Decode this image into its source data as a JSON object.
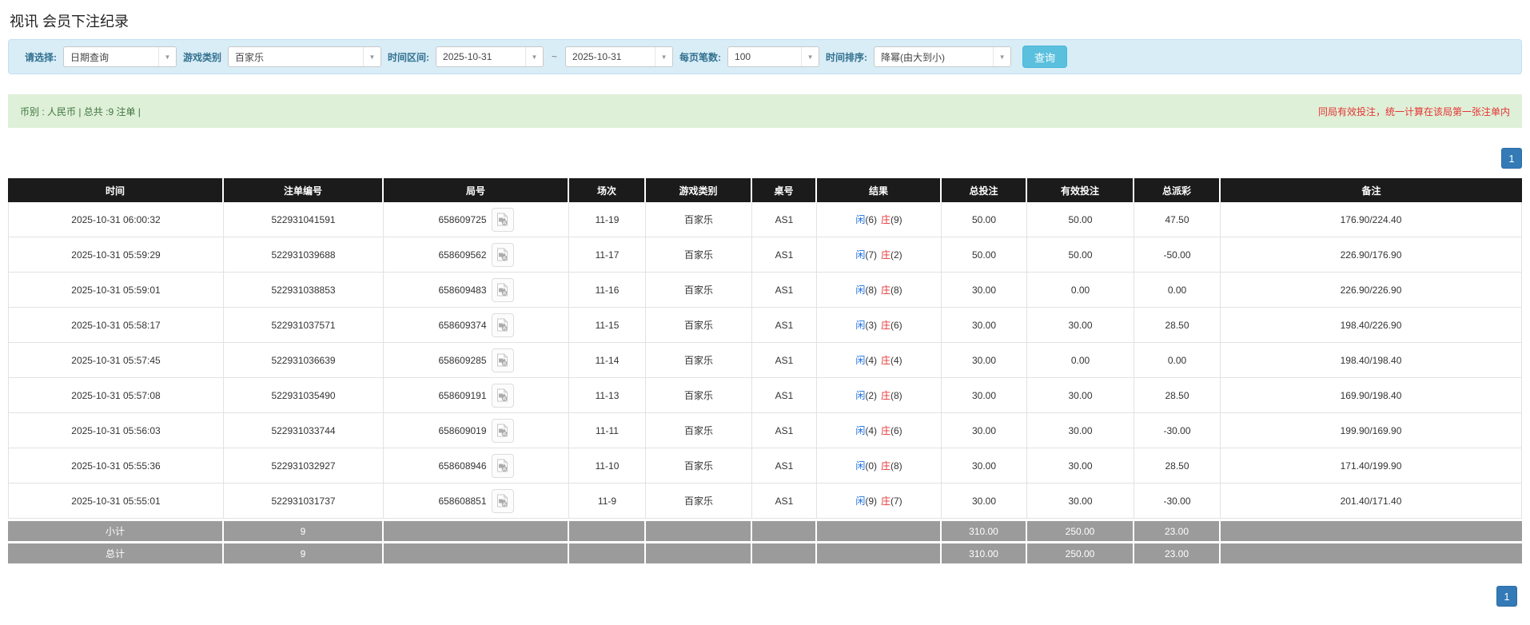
{
  "page": {
    "title": "视讯 会员下注纪录"
  },
  "filter": {
    "query_type_label": "请选择:",
    "query_type_value": "日期查询",
    "game_type_label": "游戏类别",
    "game_type_value": "百家乐",
    "time_range_label": "时间区间:",
    "date_from": "2025-10-31",
    "range_separator": "~",
    "date_to": "2025-10-31",
    "page_size_label": "每页笔数:",
    "page_size_value": "100",
    "sort_label": "时间排序:",
    "sort_value": "降幂(由大到小)",
    "search_button_label": "查询"
  },
  "info_bar": {
    "summary": "币别 : 人民币 | 总共 :9 注单 |",
    "notice": "同局有效投注，统一计算在该局第一张注单内"
  },
  "pagination": {
    "current_page": "1"
  },
  "table": {
    "headers": [
      "时间",
      "注单编号",
      "局号",
      "场次",
      "游戏类别",
      "桌号",
      "结果",
      "总投注",
      "有效投注",
      "总派彩",
      "备注"
    ],
    "rows": [
      {
        "time": "2025-10-31 06:00:32",
        "bet_id": "522931041591",
        "round_id": "658609725",
        "session": "11-19",
        "game": "百家乐",
        "table_no": "AS1",
        "player_label": "闲",
        "player_num": "(6)",
        "banker_label": "庄",
        "banker_num": "(9)",
        "total_bet": "50.00",
        "valid_bet": "50.00",
        "payout": "47.50",
        "remark": "176.90/224.40"
      },
      {
        "time": "2025-10-31 05:59:29",
        "bet_id": "522931039688",
        "round_id": "658609562",
        "session": "11-17",
        "game": "百家乐",
        "table_no": "AS1",
        "player_label": "闲",
        "player_num": "(7)",
        "banker_label": "庄",
        "banker_num": "(2)",
        "total_bet": "50.00",
        "valid_bet": "50.00",
        "payout": "-50.00",
        "remark": "226.90/176.90"
      },
      {
        "time": "2025-10-31 05:59:01",
        "bet_id": "522931038853",
        "round_id": "658609483",
        "session": "11-16",
        "game": "百家乐",
        "table_no": "AS1",
        "player_label": "闲",
        "player_num": "(8)",
        "banker_label": "庄",
        "banker_num": "(8)",
        "total_bet": "30.00",
        "valid_bet": "0.00",
        "payout": "0.00",
        "remark": "226.90/226.90"
      },
      {
        "time": "2025-10-31 05:58:17",
        "bet_id": "522931037571",
        "round_id": "658609374",
        "session": "11-15",
        "game": "百家乐",
        "table_no": "AS1",
        "player_label": "闲",
        "player_num": "(3)",
        "banker_label": "庄",
        "banker_num": "(6)",
        "total_bet": "30.00",
        "valid_bet": "30.00",
        "payout": "28.50",
        "remark": "198.40/226.90"
      },
      {
        "time": "2025-10-31 05:57:45",
        "bet_id": "522931036639",
        "round_id": "658609285",
        "session": "11-14",
        "game": "百家乐",
        "table_no": "AS1",
        "player_label": "闲",
        "player_num": "(4)",
        "banker_label": "庄",
        "banker_num": "(4)",
        "total_bet": "30.00",
        "valid_bet": "0.00",
        "payout": "0.00",
        "remark": "198.40/198.40"
      },
      {
        "time": "2025-10-31 05:57:08",
        "bet_id": "522931035490",
        "round_id": "658609191",
        "session": "11-13",
        "game": "百家乐",
        "table_no": "AS1",
        "player_label": "闲",
        "player_num": "(2)",
        "banker_label": "庄",
        "banker_num": "(8)",
        "total_bet": "30.00",
        "valid_bet": "30.00",
        "payout": "28.50",
        "remark": "169.90/198.40"
      },
      {
        "time": "2025-10-31 05:56:03",
        "bet_id": "522931033744",
        "round_id": "658609019",
        "session": "11-11",
        "game": "百家乐",
        "table_no": "AS1",
        "player_label": "闲",
        "player_num": "(4)",
        "banker_label": "庄",
        "banker_num": "(6)",
        "total_bet": "30.00",
        "valid_bet": "30.00",
        "payout": "-30.00",
        "remark": "199.90/169.90"
      },
      {
        "time": "2025-10-31 05:55:36",
        "bet_id": "522931032927",
        "round_id": "658608946",
        "session": "11-10",
        "game": "百家乐",
        "table_no": "AS1",
        "player_label": "闲",
        "player_num": "(0)",
        "banker_label": "庄",
        "banker_num": "(8)",
        "total_bet": "30.00",
        "valid_bet": "30.00",
        "payout": "28.50",
        "remark": "171.40/199.90"
      },
      {
        "time": "2025-10-31 05:55:01",
        "bet_id": "522931031737",
        "round_id": "658608851",
        "session": "11-9",
        "game": "百家乐",
        "table_no": "AS1",
        "player_label": "闲",
        "player_num": "(9)",
        "banker_label": "庄",
        "banker_num": "(7)",
        "total_bet": "30.00",
        "valid_bet": "30.00",
        "payout": "-30.00",
        "remark": "201.40/171.40"
      }
    ],
    "subtotal": {
      "label": "小计",
      "count": "9",
      "total_bet": "310.00",
      "valid_bet": "250.00",
      "payout": "23.00"
    },
    "total": {
      "label": "总计",
      "count": "9",
      "total_bet": "310.00",
      "valid_bet": "250.00",
      "payout": "23.00"
    }
  },
  "colors": {
    "header_bg": "#1b1b1b",
    "filter_bg": "#d9edf7",
    "filter_label": "#31708f",
    "info_bg": "#dff0d8",
    "info_text": "#3c763d",
    "notice_red": "#e53333",
    "link_blue": "#1b6ee3",
    "banker_red": "#e53333",
    "negative_red": "#e53333",
    "summary_bg": "#9b9b9b",
    "pager_blue": "#337ab7",
    "search_button_bg": "#5bc0de"
  }
}
